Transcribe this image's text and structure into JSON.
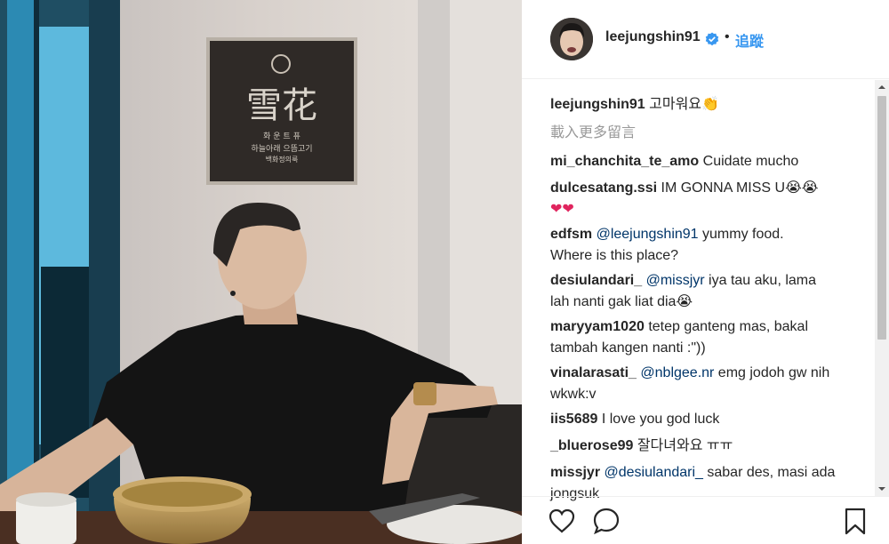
{
  "post": {
    "owner_username": "leejungshin91",
    "follow_label": "追蹤",
    "separator": "•",
    "verified_icon": "verified-badge-icon"
  },
  "sign": {
    "title": "雪花",
    "sub1": "화 운 트 퓨",
    "sub2": "하늘아래 으뜸고기",
    "sub3": "백화정의룩"
  },
  "comments": {
    "load_more": "載入更多留言",
    "items": [
      {
        "username": "leejungshin91",
        "text": " 고마워요👏"
      },
      {
        "username": "mi_chanchita_te_amo",
        "text": " Cuidate mucho"
      },
      {
        "username": "dulcesatang.ssi",
        "text": " IM GONNA MISS U😭😭",
        "line2": "❤❤"
      },
      {
        "username": "edfsm",
        "mention": " @leejungshin91",
        "text": " yummy food.",
        "line2": "Where is this place?"
      },
      {
        "username": "desiulandari_",
        "mention": " @missjyr",
        "text": " iya tau aku, lama",
        "line2": "lah nanti gak liat dia😭"
      },
      {
        "username": "maryyam1020",
        "text": " tetep ganteng mas, bakal",
        "line2": "tambah kangen nanti :\"))"
      },
      {
        "username": "vinalarasati_",
        "mention": " @nblgee.nr",
        "text": " emg jodoh gw nih",
        "line2": "wkwk:v"
      },
      {
        "username": "iis5689",
        "text": " I love you god luck"
      },
      {
        "username": "_bluerose99",
        "text": " 잘다녀와요 ㅠㅠ"
      },
      {
        "username": "missjyr",
        "mention": " @desiulandari_",
        "text": " sabar des, masi ada",
        "line2": "jongsuk"
      }
    ]
  },
  "actions": {
    "like_icon": "heart-icon",
    "comment_icon": "comment-icon",
    "save_icon": "bookmark-icon"
  },
  "colors": {
    "link_blue": "#3897f0",
    "mention_blue": "#003569",
    "text": "#262626",
    "muted": "#999999"
  }
}
